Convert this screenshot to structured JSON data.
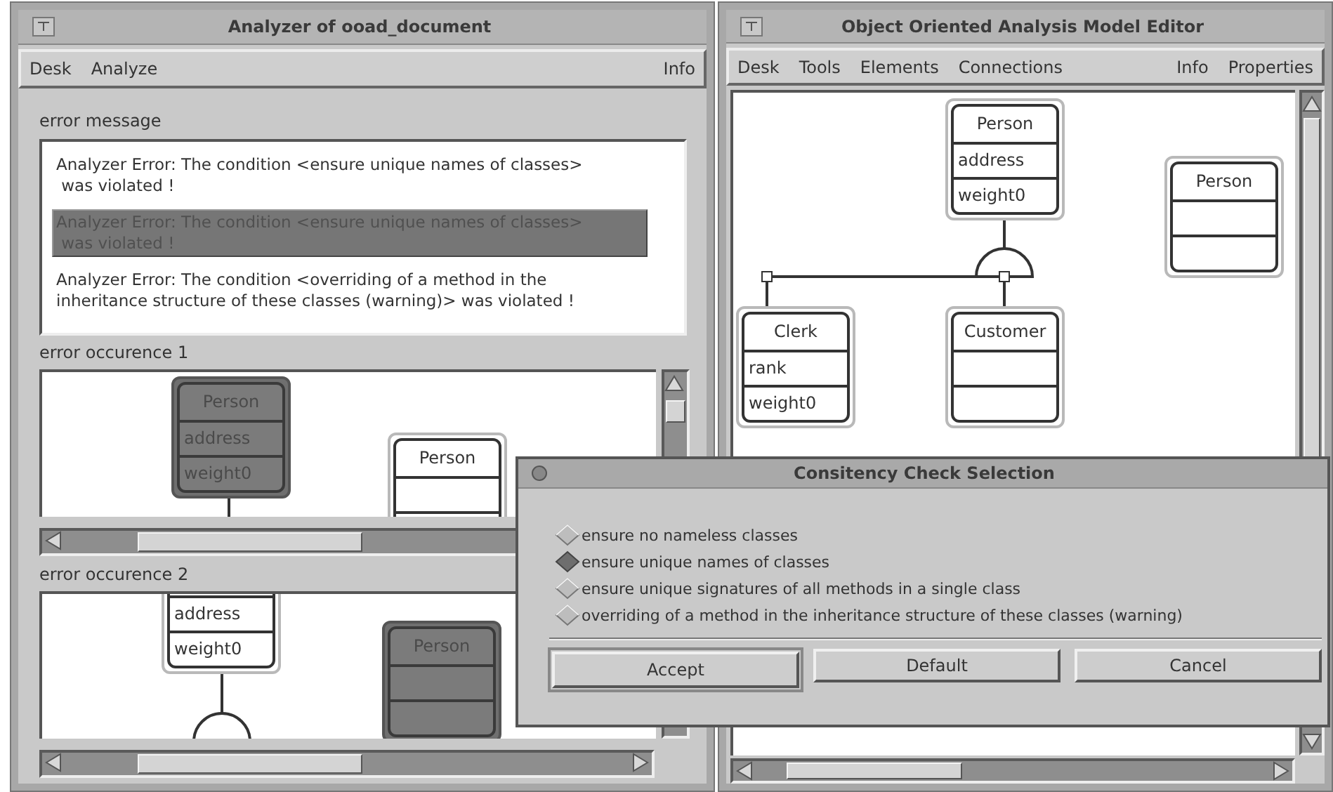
{
  "windows": [
    {
      "kind": "analyzer",
      "title": "Analyzer of ooad_document",
      "menu": [
        "Desk",
        "Analyze"
      ],
      "help_menu": [
        "Info"
      ],
      "error_message": {
        "label": "error message",
        "messages": [
          {
            "text": "Analyzer Error: The condition <ensure unique names of classes>\n was violated !",
            "selected": false
          },
          {
            "text": "Analyzer Error: The condition <ensure unique names of classes>\n was violated !",
            "selected": true
          },
          {
            "text": "Analyzer Error: The condition <overriding of a method in the\ninheritance structure of these classes (warning)> was violated !",
            "selected": false
          }
        ]
      },
      "occurrences": [
        {
          "label": "error occurence 1",
          "nodes": [
            {
              "name": "Person",
              "attributes": [
                "address"
              ],
              "methods": [
                "weight0"
              ],
              "highlighted": true
            },
            {
              "name": "Person",
              "highlighted": false
            }
          ]
        },
        {
          "label": "error occurence 2",
          "nodes": [
            {
              "attributes": [
                "address"
              ],
              "methods": [
                "weight0"
              ],
              "highlighted": false
            },
            {
              "name": "Person",
              "highlighted": true
            }
          ]
        }
      ]
    },
    {
      "kind": "editor",
      "title": "Object Oriented Analysis Model Editor",
      "menu": [
        "Desk",
        "Tools",
        "Elements",
        "Connections"
      ],
      "help_menu": [
        "Info",
        "Properties"
      ],
      "nodes": [
        {
          "name": "Person",
          "attributes": [
            "address"
          ],
          "methods": [
            "weight0"
          ],
          "highlighted": false
        },
        {
          "name": "Person",
          "highlighted": false
        },
        {
          "name": "Clerk",
          "attributes": [
            "rank"
          ],
          "methods": [
            "weight0"
          ],
          "highlighted": false
        },
        {
          "name": "Customer",
          "highlighted": false
        }
      ]
    }
  ],
  "dialog": {
    "title": "Consitency Check Selection",
    "options": [
      {
        "label": "ensure no nameless classes",
        "selected": false
      },
      {
        "label": "ensure unique names of classes",
        "selected": true
      },
      {
        "label": "ensure unique signatures of all methods in a single class",
        "selected": false
      },
      {
        "label": "overriding of a method in the inheritance structure of these classes (warning)",
        "selected": false
      }
    ],
    "buttons": [
      {
        "label": "Accept",
        "default": true
      },
      {
        "label": "Default",
        "default": false
      },
      {
        "label": "Cancel",
        "default": false
      }
    ]
  }
}
